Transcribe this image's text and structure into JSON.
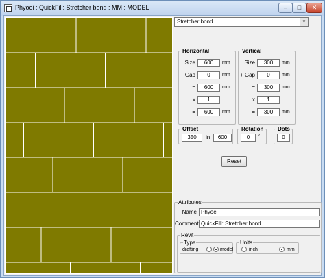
{
  "window": {
    "title": "Phyoei : QuickFill: Stretcher bond : MM : MODEL",
    "min_label": "–",
    "max_label": "□",
    "close_label": "✕"
  },
  "pattern_select": {
    "value": "Stretcher bond",
    "arrow": "▼"
  },
  "horizontal": {
    "legend": "Horizontal",
    "size_label": "Size",
    "size": "600",
    "size_unit": "mm",
    "gap_label": "+ Gap",
    "gap": "0",
    "gap_unit": "mm",
    "eq_label": "=",
    "total": "600",
    "total_unit": "mm",
    "x_label": "x",
    "count": "1",
    "eq2_label": "=",
    "result": "600",
    "result_unit": "mm"
  },
  "vertical": {
    "legend": "Vertical",
    "size_label": "Size",
    "size": "300",
    "size_unit": "mm",
    "gap_label": "+ Gap",
    "gap": "0",
    "gap_unit": "mm",
    "eq_label": "=",
    "total": "300",
    "total_unit": "mm",
    "x_label": "x",
    "count": "1",
    "eq2_label": "=",
    "result": "300",
    "result_unit": "mm"
  },
  "offset": {
    "legend": "Offset",
    "value": "350",
    "in_label": "in",
    "of": "600"
  },
  "rotation": {
    "legend": "Rotation",
    "value": "0",
    "unit": "°"
  },
  "dots": {
    "legend": "Dots",
    "value": "0"
  },
  "reset_label": "Reset",
  "attributes": {
    "legend": "Attributes",
    "name_label": "Name",
    "name_value": "Phyoei",
    "comment_label": "Comment",
    "comment_value": "QuickFill: Stretcher bond",
    "revit_legend": "Revit",
    "type_legend": "Type",
    "drafting_label": "drafting",
    "model_label": "model",
    "type_selected": "model",
    "units_legend": "Units",
    "inch_label": "inch",
    "mm_label": "mm",
    "units_selected": "mm"
  },
  "colors": {
    "hatch_fill": "#7f7a00",
    "hatch_lines": "#ffffff"
  }
}
